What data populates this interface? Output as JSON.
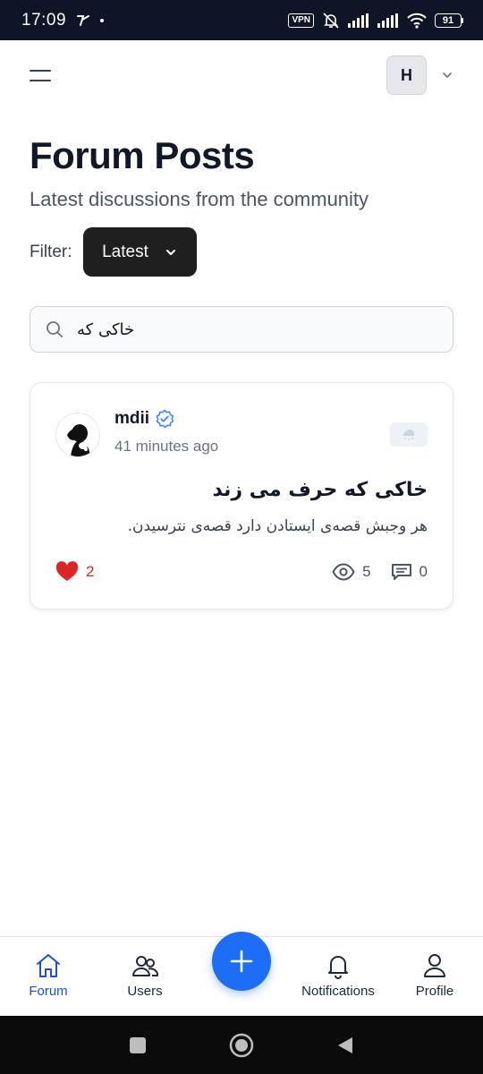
{
  "status_bar": {
    "time": "17:09",
    "vpn_label": "VPN",
    "battery_level": "91"
  },
  "header": {
    "account_initial": "H"
  },
  "page": {
    "title": "Forum Posts",
    "subtitle": "Latest discussions from the community"
  },
  "filter": {
    "label": "Filter:",
    "selected": "Latest"
  },
  "search": {
    "value": "خاکی که"
  },
  "posts": [
    {
      "author": "mdii",
      "verified": true,
      "time": "41 minutes ago",
      "title": "خاکی که حرف می زند",
      "body": "هر وجبش قصه‌ی ایستادن دارد قصه‌ی نترسیدن.",
      "likes": "2",
      "views": "5",
      "comments": "0"
    }
  ],
  "bottom_nav": {
    "items": [
      {
        "label": "Forum",
        "icon": "home-icon",
        "active": true
      },
      {
        "label": "Users",
        "icon": "users-icon",
        "active": false
      },
      {
        "label": "Notifications",
        "icon": "bell-icon",
        "active": false
      },
      {
        "label": "Profile",
        "icon": "user-icon",
        "active": false
      }
    ]
  },
  "colors": {
    "accent": "#1d6ef5",
    "active_nav": "#1d4ed8",
    "like": "#dc2626",
    "status_bar": "#0d1526",
    "filter_button": "#1f1f1f"
  }
}
